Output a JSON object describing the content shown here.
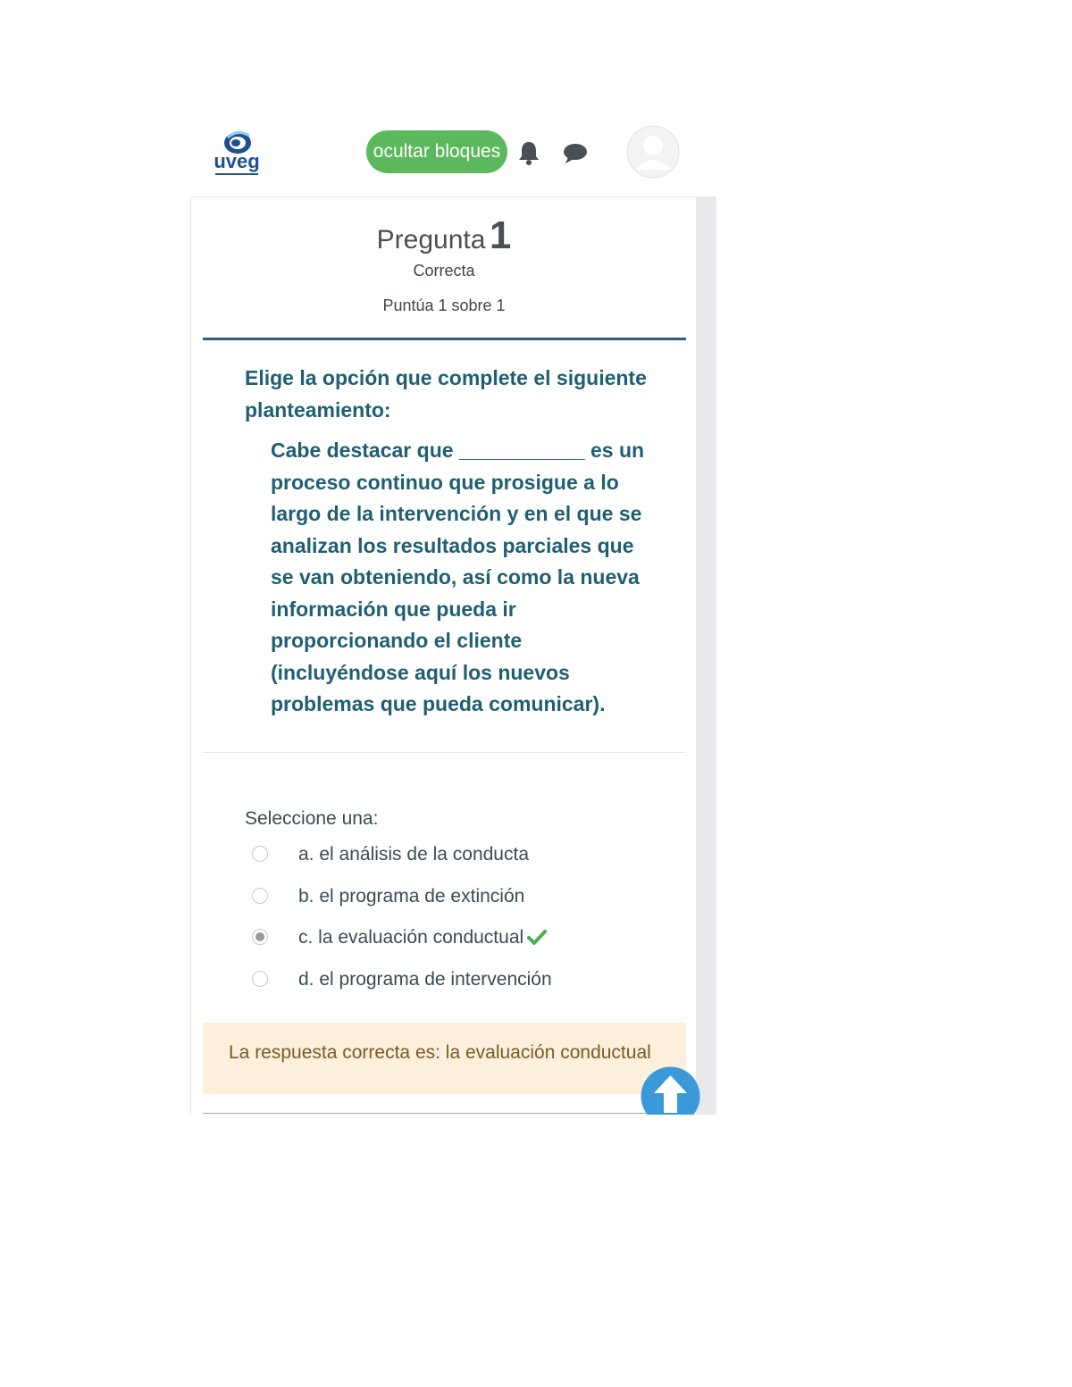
{
  "header": {
    "logo_text": "uveg",
    "hide_blocks_label": "ocultar bloques",
    "icons": [
      "bell-icon",
      "chat-icon",
      "user-avatar-icon"
    ]
  },
  "question": {
    "label": "Pregunta",
    "number": "1",
    "state": "Correcta",
    "grade": "Puntúa 1 sobre 1",
    "instruction": "Elige la opción que complete el siguiente planteamiento:",
    "text_lines": [
      "Cabe destacar que ___________ es un",
      "proceso continuo que prosigue a lo",
      "largo de la intervención y en el que se",
      "analizan los resultados parciales que",
      "se van obteniendo, así como la nueva",
      "información que pueda ir",
      "proporcionando el cliente",
      "(incluyéndose aquí los nuevos",
      "problemas que pueda comunicar)."
    ]
  },
  "answers": {
    "prompt": "Seleccione una:",
    "options": [
      {
        "label": "a. el análisis de la conducta",
        "selected": false,
        "correct_mark": false
      },
      {
        "label": "b. el programa de extinción",
        "selected": false,
        "correct_mark": false
      },
      {
        "label": "c. la evaluación conductual",
        "selected": true,
        "correct_mark": true
      },
      {
        "label": "d. el programa de intervención",
        "selected": false,
        "correct_mark": false
      }
    ]
  },
  "feedback": {
    "right_answer": "La respuesta correcta es: la evaluación conductual"
  },
  "colors": {
    "accent_green": "#5cb85c",
    "question_text": "#1f5f73",
    "rule_blue": "#2c5b85",
    "feedback_bg": "#fcefdc",
    "scroll_top_blue": "#3a9ad9"
  }
}
